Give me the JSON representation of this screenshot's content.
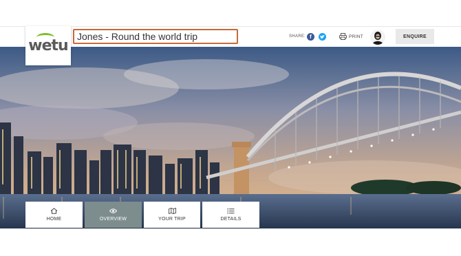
{
  "header": {
    "logo_text": "wetu",
    "title": "Jones - Round the world trip",
    "share_label": "SHARE:",
    "share_icons": [
      "facebook-icon",
      "twitter-icon"
    ],
    "print_label": "PRINT",
    "enquire_label": "ENQUIRE"
  },
  "hero": {
    "image": "sydney-harbour-bridge-night"
  },
  "nav": {
    "items": [
      {
        "label": "HOME",
        "icon": "home-icon",
        "active": false
      },
      {
        "label": "OVERVIEW",
        "icon": "eye-icon",
        "active": true
      },
      {
        "label": "YOUR TRIP",
        "icon": "map-icon",
        "active": false
      },
      {
        "label": "DETAILS",
        "icon": "list-icon",
        "active": false
      }
    ]
  },
  "colors": {
    "brand_green": "#7bbf2a",
    "title_border": "#c8693a",
    "nav_active": "#7d8d8e",
    "facebook": "#3b5998",
    "twitter": "#1da1f2"
  }
}
